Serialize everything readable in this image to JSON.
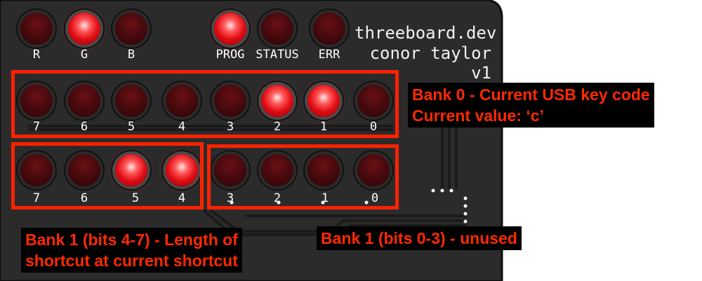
{
  "brand": {
    "line1": "threeboard.dev",
    "line2": "conor taylor",
    "line3": "v1"
  },
  "status_leds": [
    {
      "label": "R",
      "on": false
    },
    {
      "label": "G",
      "on": true
    },
    {
      "label": "B",
      "on": false
    },
    {
      "label": "PROG",
      "on": true
    },
    {
      "label": "STATUS",
      "on": false
    },
    {
      "label": "ERR",
      "on": false
    }
  ],
  "bank0": {
    "bits": [
      {
        "label": "7",
        "on": false
      },
      {
        "label": "6",
        "on": false
      },
      {
        "label": "5",
        "on": false
      },
      {
        "label": "4",
        "on": false
      },
      {
        "label": "3",
        "on": false
      },
      {
        "label": "2",
        "on": true
      },
      {
        "label": "1",
        "on": true
      },
      {
        "label": "0",
        "on": false
      }
    ]
  },
  "bank1": {
    "bits": [
      {
        "label": "7",
        "on": false
      },
      {
        "label": "6",
        "on": false
      },
      {
        "label": "5",
        "on": true
      },
      {
        "label": "4",
        "on": true
      },
      {
        "label": "3",
        "on": false
      },
      {
        "label": "2",
        "on": false
      },
      {
        "label": "1",
        "on": false
      },
      {
        "label": "0",
        "on": false
      }
    ]
  },
  "annotations": {
    "bank0_line1": "Bank 0 - Current USB key code",
    "bank0_line2": "Current value: ‘c’",
    "bank1_high_line1": "Bank 1 (bits 4-7) - Length of",
    "bank1_high_line2": "shortcut at current shortcut",
    "bank1_low": "Bank 1 (bits 0-3) - unused"
  },
  "colors": {
    "pcb": "#2b2b2b",
    "annotation_red": "#ff2a00",
    "led_on": "#ff2a2a",
    "led_off": "#4a0a0e"
  }
}
